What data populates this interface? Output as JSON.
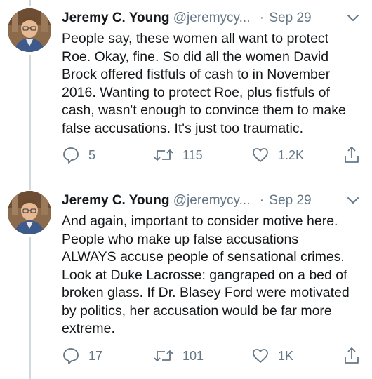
{
  "tweets": [
    {
      "name": "Jeremy C. Young",
      "handle": "@jeremycy...",
      "date": "Sep 29",
      "separator": "·",
      "lines": [
        "People say, these women all want to protect",
        "Roe. Okay, fine. So did all the women David",
        "Brock offered fistfuls of cash to in November",
        "2016. Wanting to protect Roe, plus fistfuls of",
        "cash, wasn't enough to convince them to make",
        "false accusations. It's just too traumatic."
      ],
      "replies": "5",
      "retweets": "115",
      "likes": "1.2K"
    },
    {
      "name": "Jeremy C. Young",
      "handle": "@jeremycy...",
      "date": "Sep 29",
      "separator": "·",
      "lines": [
        "And again, important to consider motive here.",
        "People who make up false accusations",
        "ALWAYS accuse people of sensational crimes.",
        "Look at Duke Lacrosse: gangraped on a bed of",
        "broken glass. If Dr. Blasey Ford were motivated",
        "by politics, her accusation would be far more",
        "extreme."
      ],
      "replies": "17",
      "retweets": "101",
      "likes": "1K"
    }
  ],
  "icons": {
    "reply": "reply-icon",
    "retweet": "retweet-icon",
    "like": "heart-icon",
    "share": "share-icon",
    "menu": "chevron-down-icon"
  },
  "colors": {
    "text": "#14171a",
    "secondary": "#657786",
    "thread_line": "#cfd9de"
  }
}
